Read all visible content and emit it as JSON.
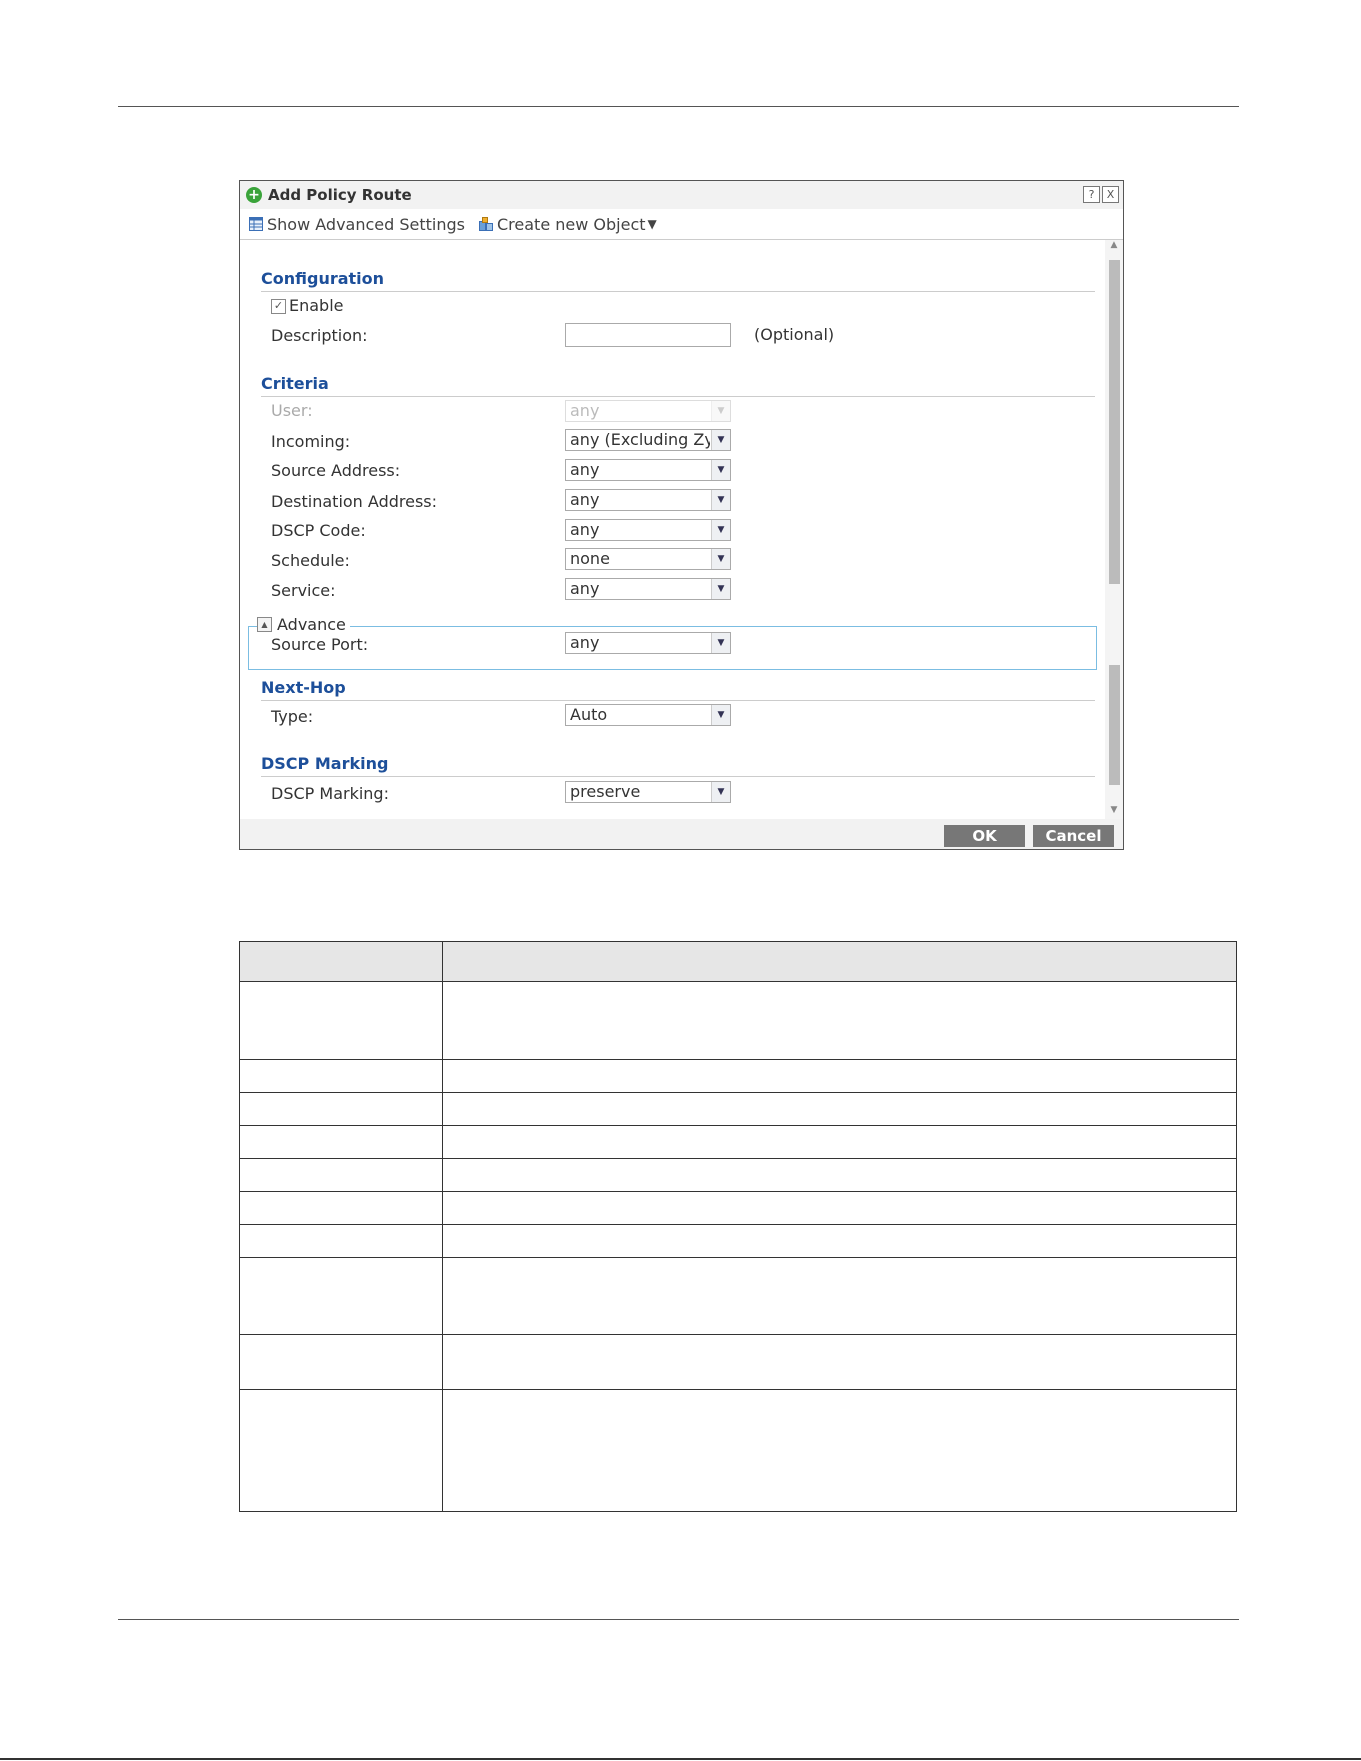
{
  "dialog": {
    "title": "Add Policy Route",
    "help_button": "?",
    "close_button": "X",
    "toolbar": {
      "show_advanced": "Show Advanced Settings",
      "create_object": "Create new Object"
    },
    "configuration": {
      "heading": "Configuration",
      "enable_label": "Enable",
      "enable_checked": true,
      "description_label": "Description:",
      "description_value": "",
      "description_hint": "(Optional)"
    },
    "criteria": {
      "heading": "Criteria",
      "user_label": "User:",
      "user_value": "any",
      "incoming_label": "Incoming:",
      "incoming_value": "any (Excluding ZyW",
      "source_address_label": "Source Address:",
      "source_address_value": "any",
      "destination_address_label": "Destination Address:",
      "destination_address_value": "any",
      "dscp_code_label": "DSCP Code:",
      "dscp_code_value": "any",
      "schedule_label": "Schedule:",
      "schedule_value": "none",
      "service_label": "Service:",
      "service_value": "any"
    },
    "advance": {
      "legend": "Advance",
      "source_port_label": "Source Port:",
      "source_port_value": "any"
    },
    "next_hop": {
      "heading": "Next-Hop",
      "type_label": "Type:",
      "type_value": "Auto"
    },
    "dscp_marking": {
      "heading": "DSCP Marking",
      "label": "DSCP Marking:",
      "value": "preserve"
    },
    "ok_label": "OK",
    "cancel_label": "Cancel"
  },
  "colors": {
    "section_heading": "#1d4f9a",
    "advance_border": "#7bbde2",
    "button_bg": "#777777"
  }
}
